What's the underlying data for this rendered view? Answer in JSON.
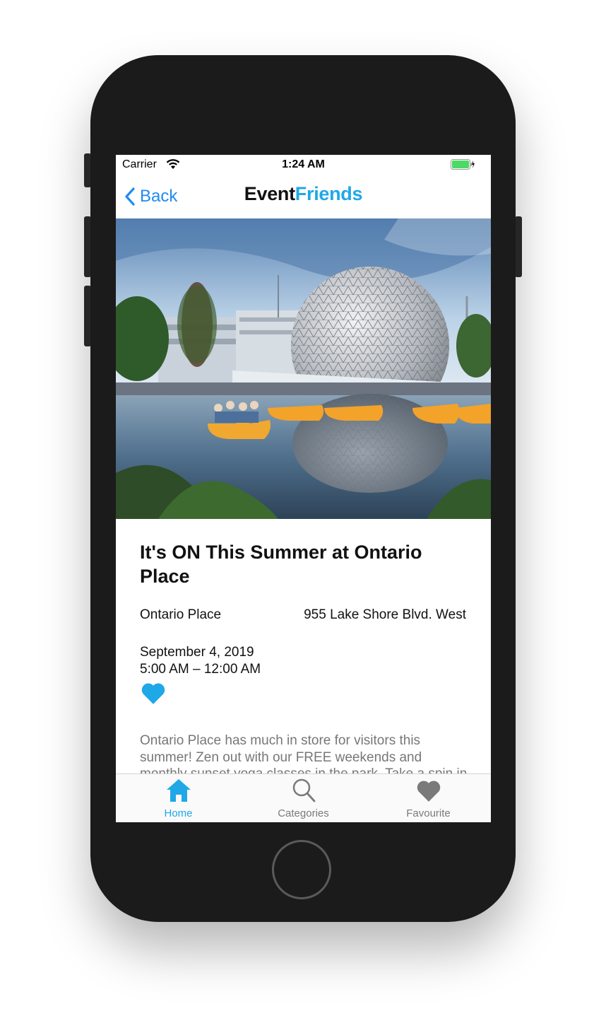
{
  "status_bar": {
    "carrier": "Carrier",
    "time": "1:24 AM"
  },
  "nav": {
    "back_label": "Back",
    "title_part1": "Event",
    "title_part2": "Friends"
  },
  "event": {
    "title": "It's ON This Summer at Ontario Place",
    "venue": "Ontario Place",
    "address": "955 Lake Shore Blvd. West",
    "date": "September 4, 2019",
    "time_range": "5:00 AM – 12:00 AM",
    "description": " Ontario Place has much in store for visitors this summer! Zen out with our FREE weekends and monthly sunset yoga classes in the park. Take a spin in"
  },
  "tabs": [
    {
      "label": "Home",
      "icon": "house-icon",
      "active": true
    },
    {
      "label": "Categories",
      "icon": "magnifier-icon",
      "active": false
    },
    {
      "label": "Favourite",
      "icon": "heart-icon",
      "active": false
    }
  ],
  "colors": {
    "accent": "#1ea8e8",
    "back": "#1f8bf0",
    "inactive": "#7a7a7a",
    "phone_body": "#1b1b1b"
  }
}
